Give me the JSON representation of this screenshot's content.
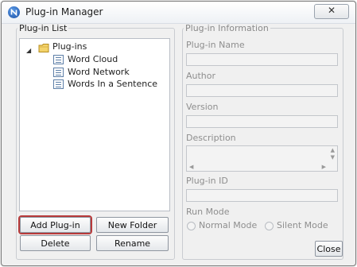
{
  "window": {
    "title": "Plug-in Manager",
    "close_glyph": "✕"
  },
  "plugin_list": {
    "legend": "Plug-in List",
    "folder": "Plug-ins",
    "items": [
      "Word Cloud",
      "Word Network",
      "Words In a Sentence"
    ],
    "buttons": {
      "add": "Add Plug-in",
      "new_folder": "New Folder",
      "delete": "Delete",
      "rename": "Rename"
    }
  },
  "plugin_info": {
    "legend": "Plug-in Information",
    "fields": {
      "name": "Plug-in Name",
      "author": "Author",
      "version": "Version",
      "description": "Description",
      "id": "Plug-in ID"
    },
    "run_mode": {
      "label": "Run Mode",
      "options": [
        "Normal Mode",
        "Silent Mode"
      ]
    },
    "close_button": "Close"
  },
  "colors": {
    "highlight_border": "#b83a3a",
    "disabled_text": "#8e8e8e"
  }
}
